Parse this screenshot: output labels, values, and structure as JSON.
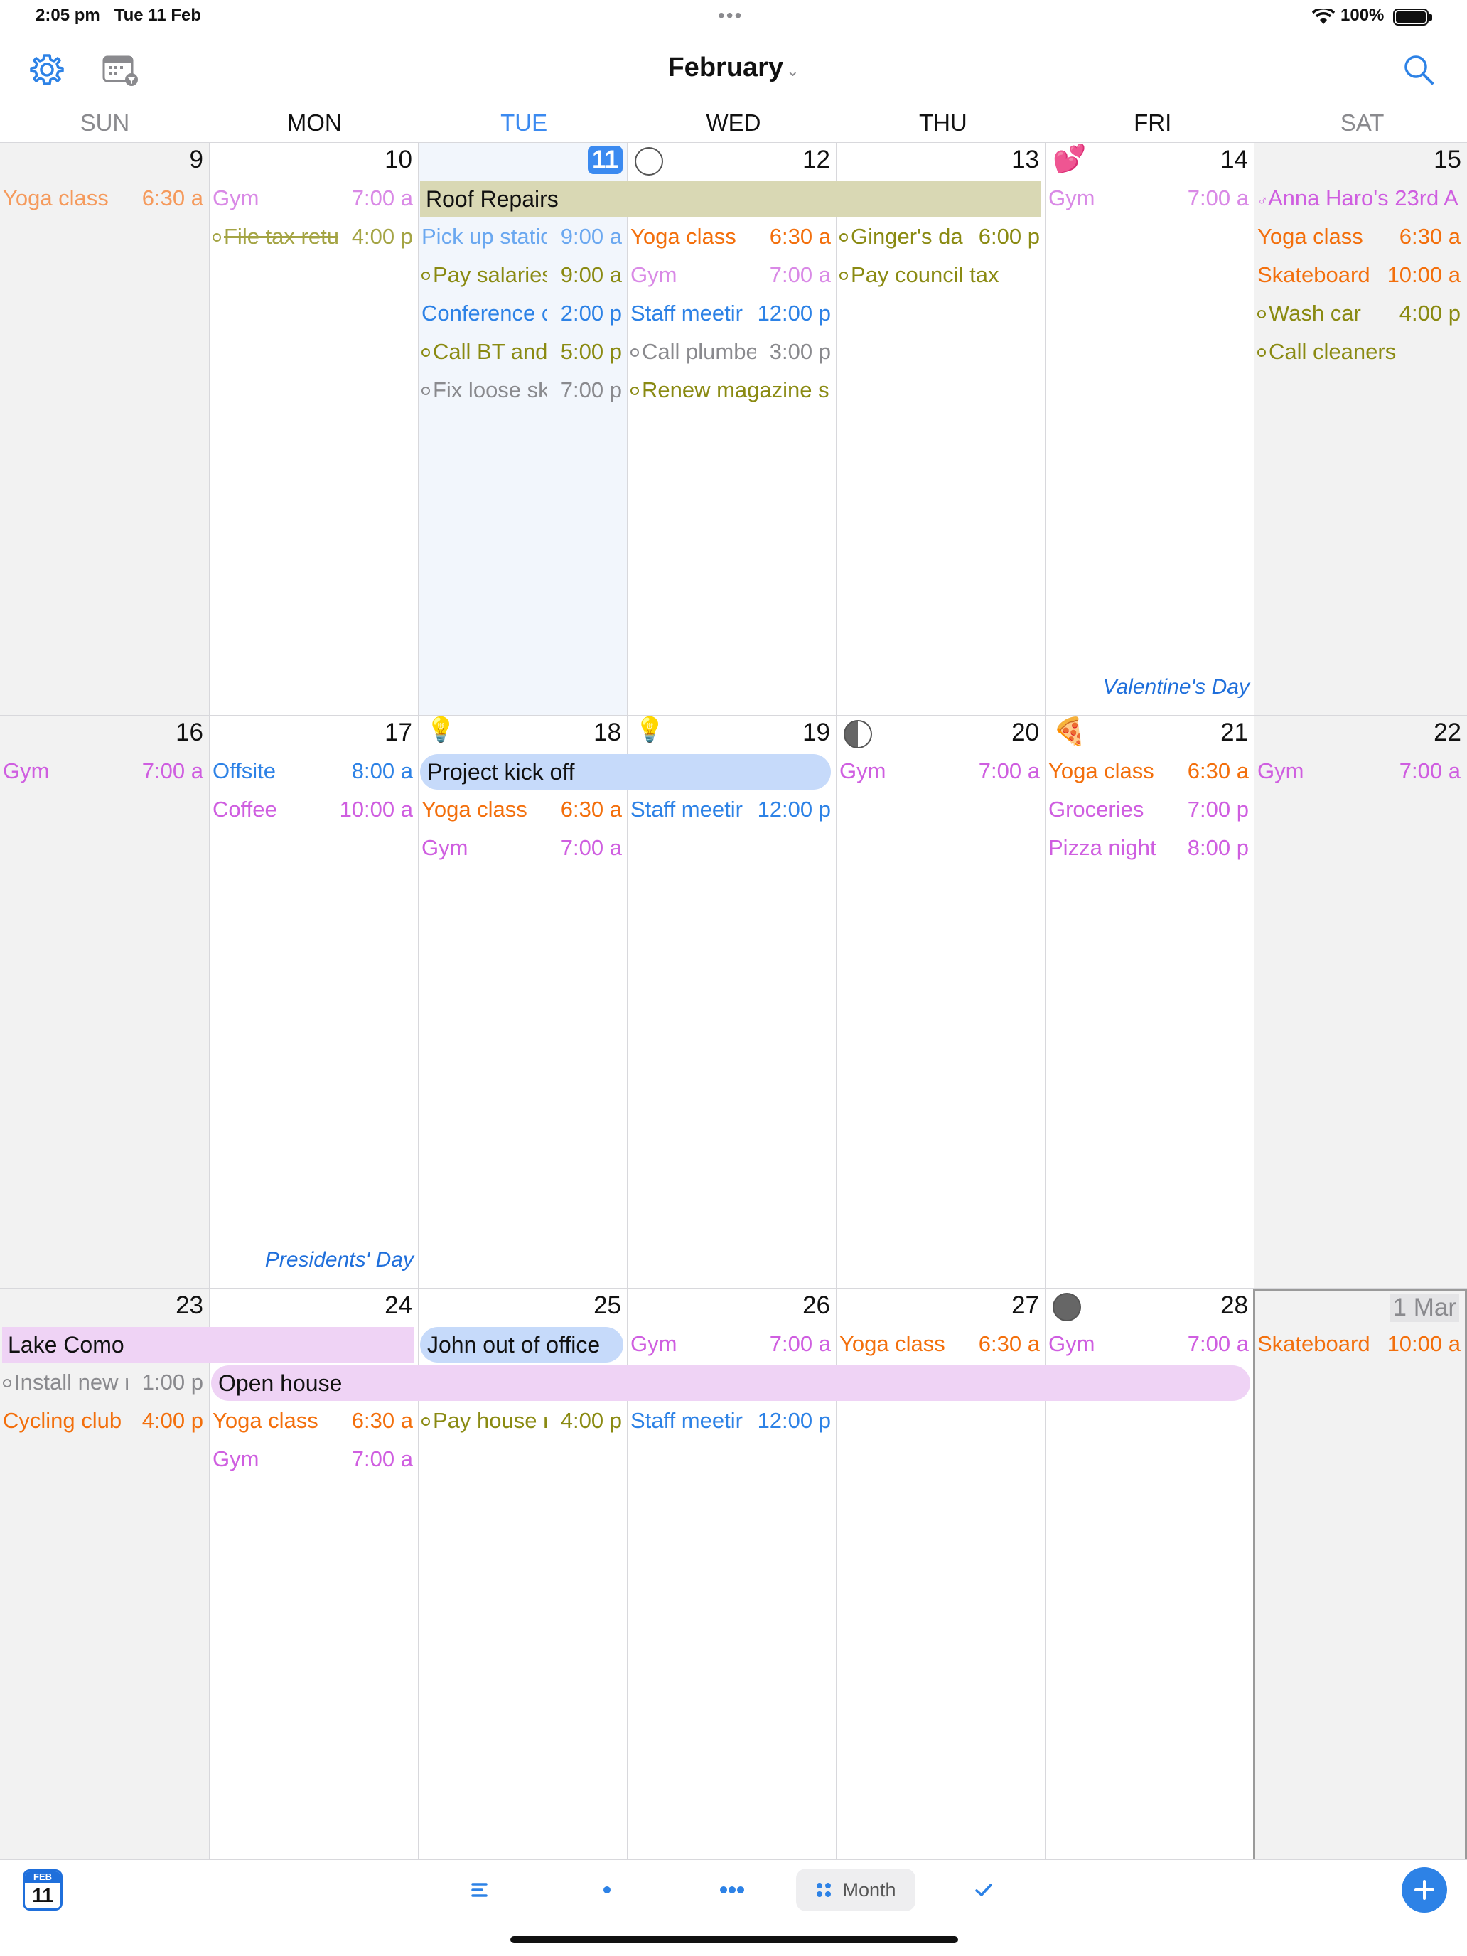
{
  "status": {
    "time": "2:05 pm",
    "date": "Tue 11 Feb",
    "battery": "100%"
  },
  "toolbar": {
    "title": "February"
  },
  "weekdays": [
    "SUN",
    "MON",
    "TUE",
    "WED",
    "THU",
    "FRI",
    "SAT"
  ],
  "weeks": [
    {
      "days": [
        "9",
        "10",
        "11",
        "12",
        "13",
        "14",
        "15"
      ],
      "holidays": {
        "fri": "Valentine's Day"
      },
      "bars": [
        {
          "label": "Roof Repairs",
          "color": "#d9d8b4"
        }
      ],
      "events": {
        "sun": [
          {
            "title": "Yoga class",
            "time": "6:30 a"
          }
        ],
        "mon": [
          {
            "title": "Gym",
            "time": "7:00 a"
          },
          {
            "title": "File tax retu",
            "time": "4:00 p"
          }
        ],
        "tue": [
          {
            "title": "Pick up statio",
            "time": "9:00 a"
          },
          {
            "title": "Pay salaries",
            "time": "9:00 a"
          },
          {
            "title": "Conference c",
            "time": "2:00 p"
          },
          {
            "title": "Call BT and",
            "time": "5:00 p"
          },
          {
            "title": "Fix loose sk",
            "time": "7:00 p"
          }
        ],
        "wed": [
          {
            "title": "Yoga class",
            "time": "6:30 a"
          },
          {
            "title": "Gym",
            "time": "7:00 a"
          },
          {
            "title": "Staff meetir",
            "time": "12:00 p"
          },
          {
            "title": "Call plumbe",
            "time": "3:00 p"
          },
          {
            "title": "Renew magazine s",
            "time": ""
          }
        ],
        "thu": [
          {
            "title": "Ginger's da",
            "time": "6:00 p"
          },
          {
            "title": "Pay council tax",
            "time": ""
          }
        ],
        "fri": [
          {
            "title": "Gym",
            "time": "7:00 a"
          }
        ],
        "sat": [
          {
            "title": "Anna Haro's 23rd A",
            "time": ""
          },
          {
            "title": "Yoga class",
            "time": "6:30 a"
          },
          {
            "title": "Skateboard",
            "time": "10:00 a"
          },
          {
            "title": "Wash car",
            "time": "4:00 p"
          },
          {
            "title": "Call cleaners",
            "time": ""
          }
        ]
      }
    },
    {
      "days": [
        "16",
        "17",
        "18",
        "19",
        "20",
        "21",
        "22"
      ],
      "holidays": {
        "mon": "Presidents' Day"
      },
      "bars": [
        {
          "label": "Project kick off",
          "color": "#c6dafa"
        }
      ],
      "events": {
        "sun": [
          {
            "title": "Gym",
            "time": "7:00 a"
          }
        ],
        "mon": [
          {
            "title": "Offsite",
            "time": "8:00 a"
          },
          {
            "title": "Coffee",
            "time": "10:00 a"
          }
        ],
        "tue": [
          {
            "title": "Yoga class",
            "time": "6:30 a"
          },
          {
            "title": "Gym",
            "time": "7:00 a"
          }
        ],
        "wed": [
          {
            "title": "Staff meetir",
            "time": "12:00 p"
          }
        ],
        "thu": [
          {
            "title": "Gym",
            "time": "7:00 a"
          }
        ],
        "fri": [
          {
            "title": "Yoga class",
            "time": "6:30 a"
          },
          {
            "title": "Groceries",
            "time": "7:00 p"
          },
          {
            "title": "Pizza night",
            "time": "8:00 p"
          }
        ],
        "sat": [
          {
            "title": "Gym",
            "time": "7:00 a"
          }
        ]
      }
    },
    {
      "days": [
        "23",
        "24",
        "25",
        "26",
        "27",
        "28",
        "1 Mar"
      ],
      "holidays": {},
      "bars": [
        {
          "label": "Lake Como",
          "color": "#efd3f5"
        },
        {
          "label": "John out of office",
          "color": "#c6dafa"
        },
        {
          "label": "Open house",
          "color": "#efd3f5"
        }
      ],
      "events": {
        "sun": [
          {
            "title": "Install new r",
            "time": "1:00 p"
          },
          {
            "title": "Cycling club",
            "time": "4:00 p"
          }
        ],
        "mon": [
          {
            "title": "Yoga class",
            "time": "6:30 a"
          },
          {
            "title": "Gym",
            "time": "7:00 a"
          }
        ],
        "tue": [
          {
            "title": "Pay house r",
            "time": "4:00 p"
          }
        ],
        "wed": [
          {
            "title": "Gym",
            "time": "7:00 a"
          },
          {
            "title": "Staff meetir",
            "time": "12:00 p"
          }
        ],
        "thu": [
          {
            "title": "Yoga class",
            "time": "6:30 a"
          }
        ],
        "fri": [
          {
            "title": "Gym",
            "time": "7:00 a"
          }
        ],
        "sat": [
          {
            "title": "Skateboard",
            "time": "10:00 a"
          }
        ]
      }
    }
  ],
  "bottombar": {
    "today_month": "FEB",
    "today_day": "11",
    "view_label": "Month"
  },
  "colors": {
    "accent": "#2d82e6",
    "today": "#3b8af0"
  }
}
